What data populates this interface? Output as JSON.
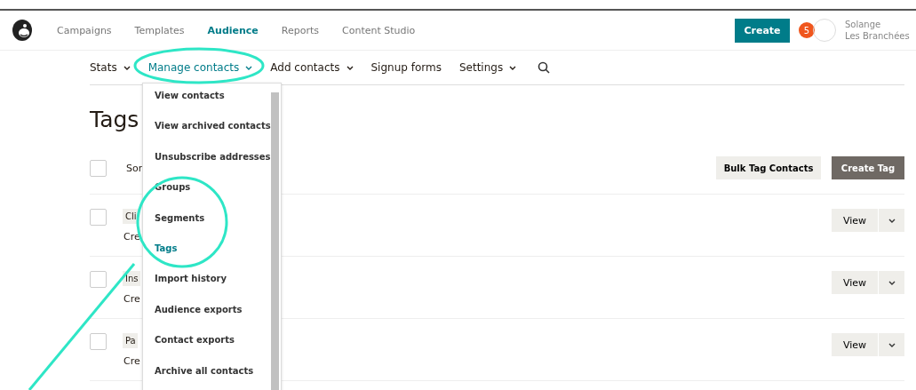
{
  "top_nav": {
    "items": [
      {
        "label": "Campaigns",
        "selected": false
      },
      {
        "label": "Templates",
        "selected": false
      },
      {
        "label": "Audience",
        "selected": true
      },
      {
        "label": "Reports",
        "selected": false
      },
      {
        "label": "Content Studio",
        "selected": false
      }
    ],
    "create_button": "Create",
    "notification_count": "5",
    "account_name": [
      "Solange",
      "Les Branchées"
    ]
  },
  "sub_nav": [
    {
      "label": "Stats",
      "kind": "dropdown",
      "expanded": false
    },
    {
      "label": "Manage contacts",
      "kind": "dropdown",
      "expanded": true
    },
    {
      "label": "Add contacts",
      "kind": "dropdown",
      "expanded": false
    },
    {
      "label": "Signup forms",
      "kind": "link",
      "expanded": false
    },
    {
      "label": "Settings",
      "kind": "dropdown",
      "expanded": false
    }
  ],
  "page_title": "Tags",
  "sort_label": "Sor",
  "select_all_checked": false,
  "bulk_button": "Bulk Tag Contacts",
  "create_tag_button": "Create Tag",
  "rows": [
    {
      "tag": "Cli",
      "created": "Cre",
      "view": "View",
      "checked": false
    },
    {
      "tag": "Ins",
      "created": "Cre",
      "view": "View",
      "checked": false
    },
    {
      "tag": "Pa",
      "created": "Cre",
      "view": "View",
      "checked": false
    }
  ],
  "dropdown_menu": [
    {
      "label": "View contacts",
      "selected": false
    },
    {
      "label": "View archived contacts",
      "selected": false
    },
    {
      "label": "Unsubscribe addresses",
      "selected": false
    },
    {
      "label": "Groups",
      "selected": false
    },
    {
      "label": "Segments",
      "selected": false
    },
    {
      "label": "Tags",
      "selected": true
    },
    {
      "label": "Import history",
      "selected": false
    },
    {
      "label": "Audience exports",
      "selected": false
    },
    {
      "label": "Contact exports",
      "selected": false
    },
    {
      "label": "Archive all contacts",
      "selected": false
    }
  ]
}
